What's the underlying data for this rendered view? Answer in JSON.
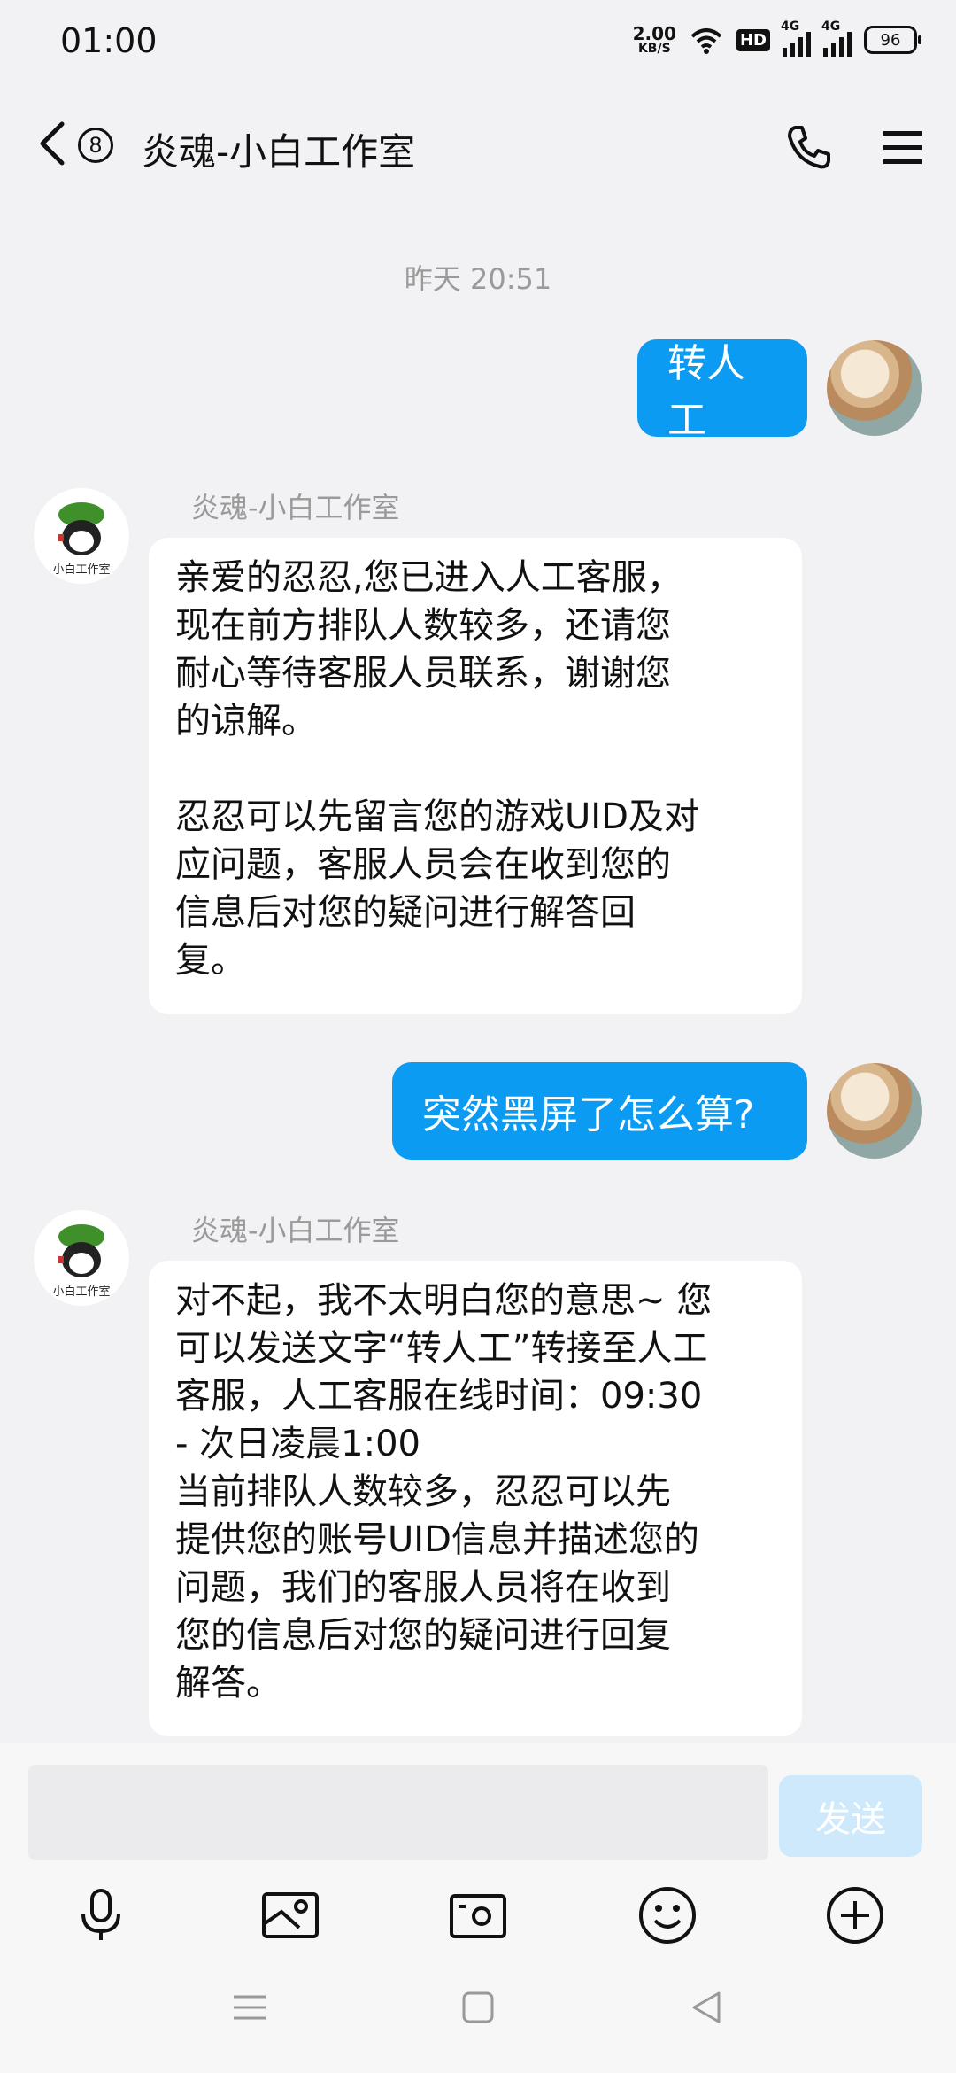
{
  "status_bar": {
    "time": "01:00",
    "net_speed_value": "2.00",
    "net_speed_unit": "KB/S",
    "hd_label": "HD",
    "sim1_label": "4G",
    "sim2_label": "4G",
    "battery": "96"
  },
  "header": {
    "unread_count": "8",
    "title": "炎魂-小白工作室"
  },
  "chat": {
    "timestamp": "昨天 20:51",
    "messages": [
      {
        "from": "self",
        "text": "转人工"
      },
      {
        "from": "other",
        "sender": "炎魂-小白工作室",
        "text": "亲爱的忍忍,您已进入人工客服，\n现在前方排队人数较多，还请您\n耐心等待客服人员联系，谢谢您\n的谅解。\n\n忍忍可以先留言您的游戏UID及对\n应问题，客服人员会在收到您的\n信息后对您的疑问进行解答回\n复。"
      },
      {
        "from": "self",
        "text": "突然黑屏了怎么算?"
      },
      {
        "from": "other",
        "sender": "炎魂-小白工作室",
        "text": "对不起，我不太明白您的意思~ 您\n可以发送文字“转人工”转接至人工\n客服，人工客服在线时间：09:30\n- 次日凌晨1:00\n当前排队人数较多，忍忍可以先\n提供您的账号UID信息并描述您的\n问题，我们的客服人员将在收到\n您的信息后对您的疑问进行回复\n解答。"
      }
    ],
    "avatar_caption": "小白工作室"
  },
  "input": {
    "value": "",
    "send_label": "发送"
  },
  "icons": {
    "toolbar": [
      "microphone-icon",
      "image-icon",
      "camera-icon",
      "emoji-icon",
      "add-icon"
    ],
    "nav": [
      "menu-nav-icon",
      "home-nav-icon",
      "back-nav-icon"
    ]
  },
  "colors": {
    "accent": "#0b9bf2",
    "send_disabled": "#cde9fb",
    "background": "#f2f2f4"
  }
}
